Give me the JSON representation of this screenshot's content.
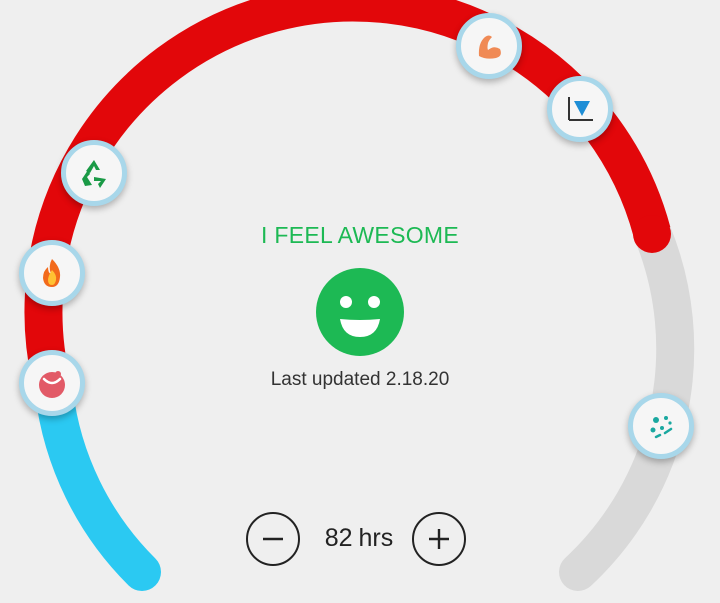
{
  "mood": {
    "label": "I FEEL AWESOME",
    "face": "smiling-face-icon",
    "last_updated_label": "Last updated",
    "last_updated_date": "2.18.20"
  },
  "hours": {
    "value": "82",
    "unit": "hrs",
    "decrement": "minus-icon",
    "increment": "plus-icon"
  },
  "gauge": {
    "segments": [
      {
        "name": "blue-segment",
        "color": "#2bc9f2"
      },
      {
        "name": "red-segment",
        "color": "#e2070a"
      },
      {
        "name": "grey-segment",
        "color": "#d9d9d9"
      }
    ]
  },
  "milestones": [
    {
      "icon": "bite-mark-icon"
    },
    {
      "icon": "fire-icon"
    },
    {
      "icon": "recycle-icon"
    },
    {
      "icon": "flexed-arm-icon"
    },
    {
      "icon": "funnel-chart-icon"
    },
    {
      "icon": "bacteria-icon"
    }
  ],
  "colors": {
    "accent_green": "#1db954",
    "gauge_red": "#e2070a",
    "gauge_blue": "#2bc9f2",
    "gauge_grey": "#d9d9d9",
    "node_ring": "#a8d7ea",
    "background": "#efefef"
  }
}
